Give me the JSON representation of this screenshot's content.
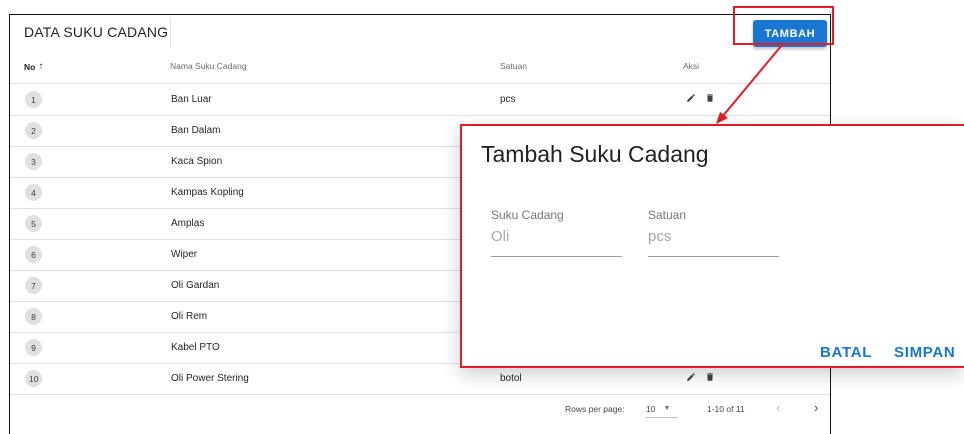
{
  "card": {
    "title": "DATA SUKU CADANG",
    "add_button": "TAMBAH"
  },
  "table": {
    "headers": {
      "no": "No",
      "nama": "Nama Suku Cadang",
      "satuan": "Satuan",
      "aksi": "Aksi"
    },
    "sort_icon": "arrow-up-icon",
    "rows": [
      {
        "no": "1",
        "nama": "Ban Luar",
        "satuan": "pcs"
      },
      {
        "no": "2",
        "nama": "Ban Dalam",
        "satuan": ""
      },
      {
        "no": "3",
        "nama": "Kaca Spion",
        "satuan": ""
      },
      {
        "no": "4",
        "nama": "Kampas Kopling",
        "satuan": ""
      },
      {
        "no": "5",
        "nama": "Amplas",
        "satuan": ""
      },
      {
        "no": "6",
        "nama": "Wiper",
        "satuan": ""
      },
      {
        "no": "7",
        "nama": "Oli Gardan",
        "satuan": ""
      },
      {
        "no": "8",
        "nama": "Oli Rem",
        "satuan": ""
      },
      {
        "no": "9",
        "nama": "Kabel PTO",
        "satuan": ""
      },
      {
        "no": "10",
        "nama": "Oli Power Stering",
        "satuan": "botol"
      }
    ],
    "row_action_icons": [
      "pencil-icon",
      "trash-icon"
    ]
  },
  "pagination": {
    "rows_per_page_label": "Rows per page:",
    "rows_per_page_value": "10",
    "page_info": "1-10 of 11",
    "prev_symbol": "‹",
    "next_symbol": "›"
  },
  "dialog": {
    "title": "Tambah Suku Cadang",
    "fields": [
      {
        "label": "Suku Cadang",
        "placeholder": "Oli"
      },
      {
        "label": "Satuan",
        "placeholder": "pcs"
      }
    ],
    "cancel_label": "BATAL",
    "save_label": "SIMPAN"
  },
  "colors": {
    "primary": "#1976d2",
    "annotation": "#e51c23"
  }
}
